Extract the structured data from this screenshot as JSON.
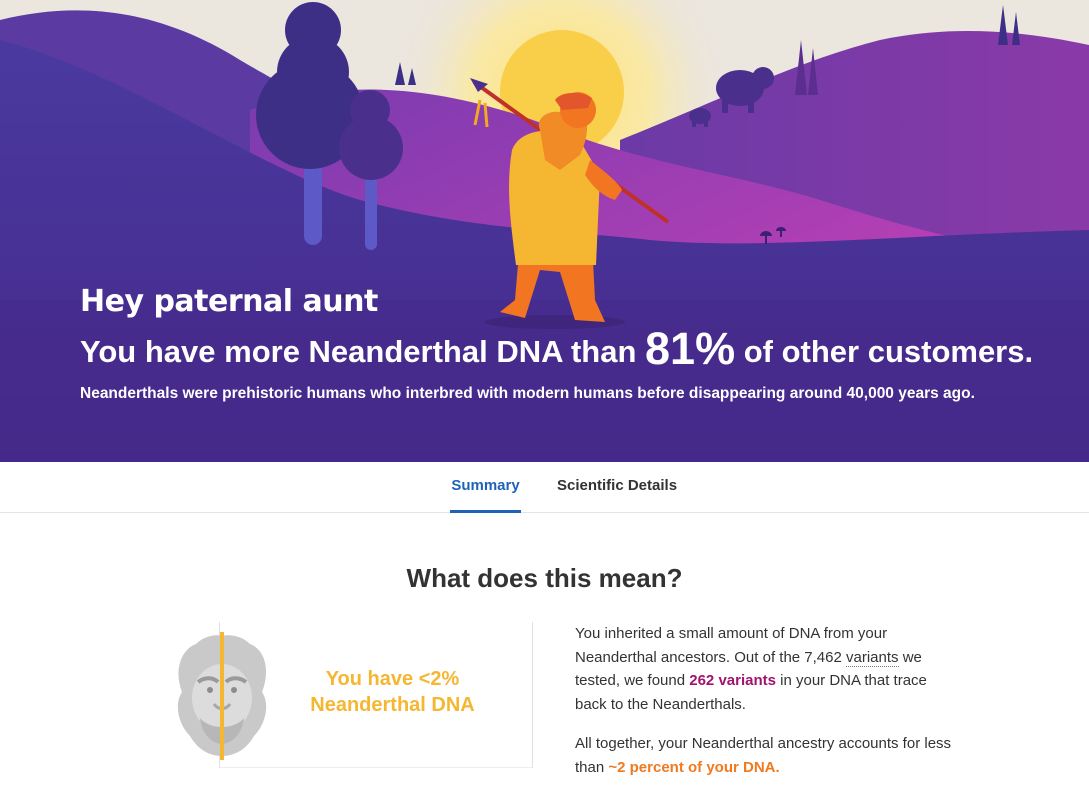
{
  "hero": {
    "greeting": "Hey paternal aunt",
    "headline_before": "You have more Neanderthal DNA than",
    "headline_percent": "81%",
    "headline_after": "of other customers.",
    "subtitle": "Neanderthals were prehistoric humans who interbred with modern humans before disappearing around 40,000 years ago."
  },
  "tabs": [
    {
      "label": "Summary",
      "active": true
    },
    {
      "label": "Scientific Details",
      "active": false
    }
  ],
  "section": {
    "title": "What does this mean?"
  },
  "card": {
    "stat_line1": "You have <2%",
    "stat_line2": "Neanderthal DNA",
    "icon": "neanderthal-face-icon"
  },
  "explanation": {
    "p1_part1": "You inherited a small amount of DNA from your Neanderthal ancestors. Out of the 7,462",
    "p1_variants_link": "variants",
    "p1_part2": "we tested, we found",
    "p1_highlight": "262 variants",
    "p1_part3": "in your DNA that trace back to the Neanderthals.",
    "p2_part1": "All together, your Neanderthal ancestry accounts for less than",
    "p2_highlight": "~2 percent of your DNA."
  },
  "colors": {
    "accent_blue": "#1e63b8",
    "stat_yellow": "#f5b731",
    "highlight_purple": "#a0136e",
    "highlight_orange": "#f07a1f",
    "hero_purple": "#4b2e91"
  }
}
